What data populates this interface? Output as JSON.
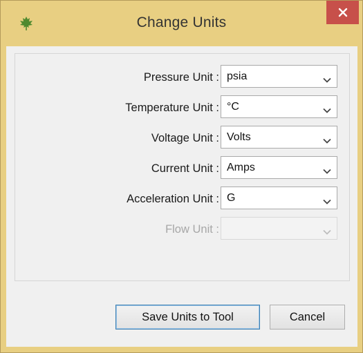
{
  "window": {
    "title": "Change Units",
    "icon": "maple-leaf-icon",
    "close_icon": "close-icon"
  },
  "fields": [
    {
      "label": "Pressure Unit :",
      "value": "psia",
      "enabled": true
    },
    {
      "label": "Temperature Unit :",
      "value": "°C",
      "enabled": true
    },
    {
      "label": "Voltage Unit :",
      "value": "Volts",
      "enabled": true
    },
    {
      "label": "Current Unit :",
      "value": "Amps",
      "enabled": true
    },
    {
      "label": "Acceleration Unit :",
      "value": "G",
      "enabled": true
    },
    {
      "label": "Flow Unit :",
      "value": "",
      "enabled": false
    }
  ],
  "buttons": {
    "save_label": "Save Units to Tool",
    "cancel_label": "Cancel"
  },
  "colors": {
    "titlebar": "#e8cf82",
    "close_button": "#c7504a",
    "client_background": "#f0f0f0",
    "disabled_text": "#a7a7a7"
  }
}
